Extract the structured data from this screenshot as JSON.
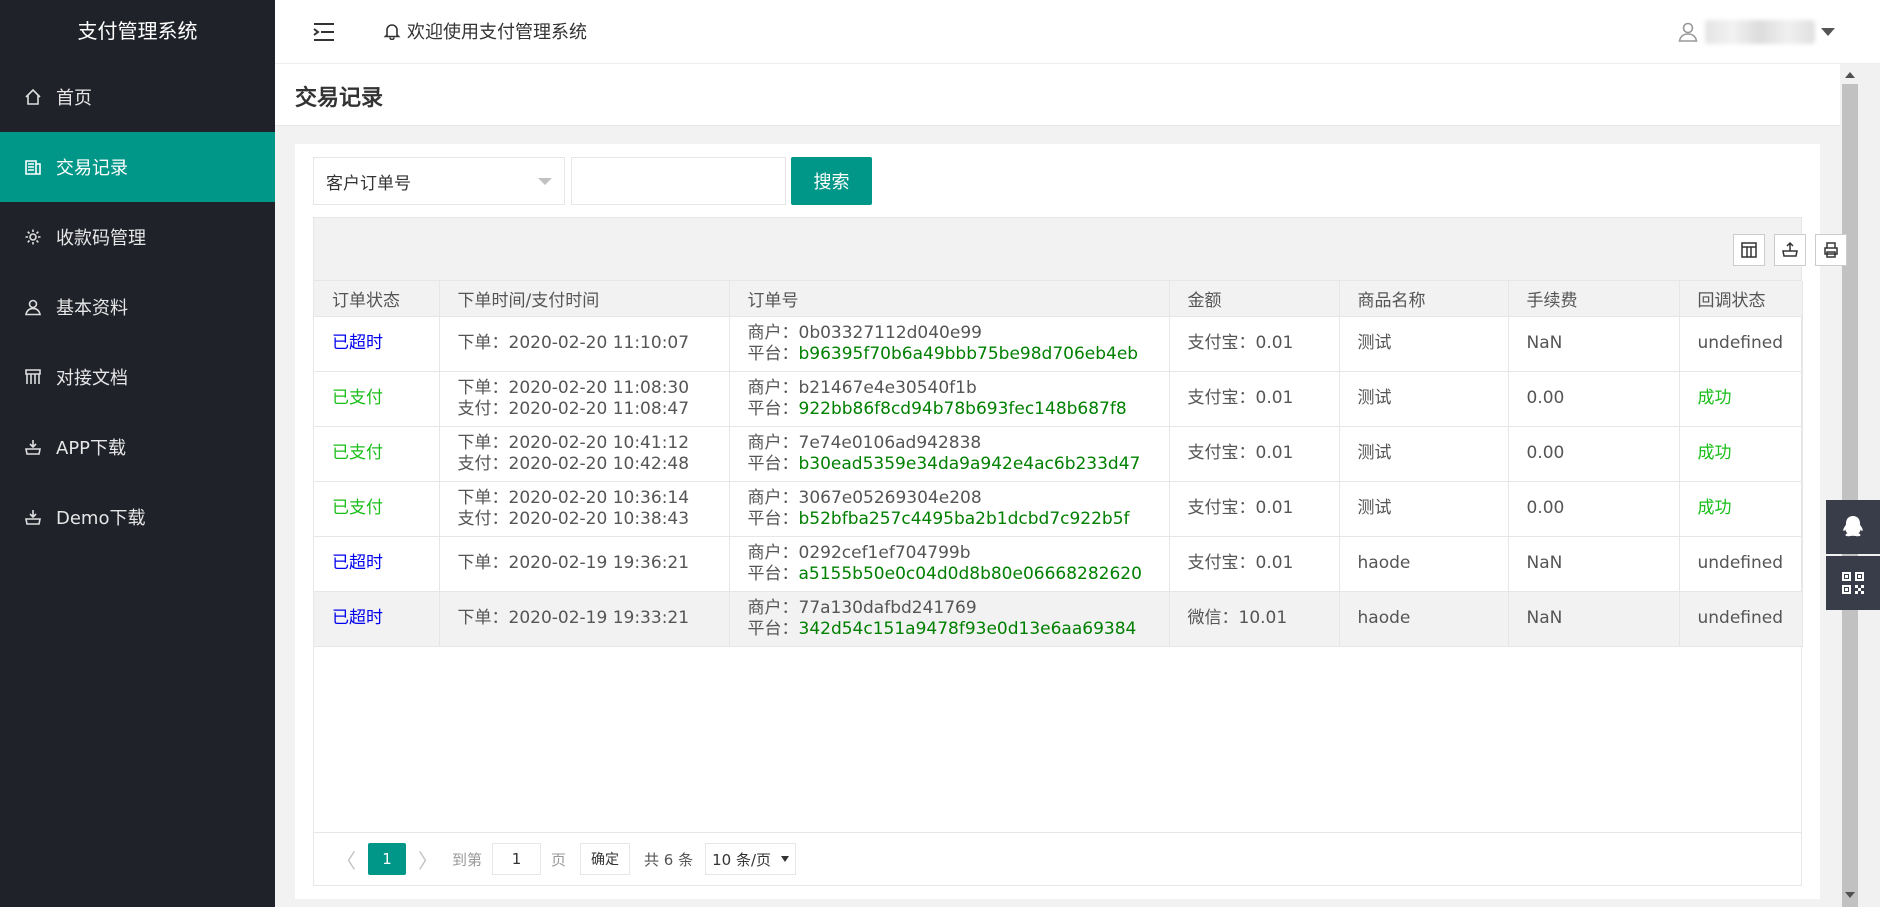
{
  "app": {
    "title": "支付管理系统"
  },
  "sidebar": {
    "items": [
      {
        "label": "首页",
        "icon": "home-icon"
      },
      {
        "label": "交易记录",
        "icon": "records-icon",
        "active": true
      },
      {
        "label": "收款码管理",
        "icon": "gear-icon"
      },
      {
        "label": "基本资料",
        "icon": "user-icon"
      },
      {
        "label": "对接文档",
        "icon": "docs-icon"
      },
      {
        "label": "APP下载",
        "icon": "download-icon"
      },
      {
        "label": "Demo下载",
        "icon": "download-icon"
      }
    ]
  },
  "header": {
    "welcome": "欢迎使用支付管理系统"
  },
  "page": {
    "title": "交易记录"
  },
  "filter": {
    "select_value": "客户订单号",
    "input_value": "",
    "search_label": "搜索"
  },
  "table": {
    "columns": [
      "订单状态",
      "下单时间/支付时间",
      "订单号",
      "金额",
      "商品名称",
      "手续费",
      "回调状态"
    ],
    "rows": [
      {
        "status": "已超时",
        "status_type": "timeout",
        "order_time": "下单：2020-02-20 11:10:07",
        "pay_time": "",
        "merchant_no": "商户：0b03327112d040e99",
        "platform_label": "平台：",
        "platform_no": "b96395f70b6a49bbb75be98d706eb4eb",
        "amount": "支付宝：0.01",
        "product": "测试",
        "fee": "NaN",
        "callback": "undefined",
        "callback_type": "none"
      },
      {
        "status": "已支付",
        "status_type": "paid",
        "order_time": "下单：2020-02-20 11:08:30",
        "pay_time": "支付：2020-02-20 11:08:47",
        "merchant_no": "商户：b21467e4e30540f1b",
        "platform_label": "平台：",
        "platform_no": "922bb86f8cd94b78b693fec148b687f8",
        "amount": "支付宝：0.01",
        "product": "测试",
        "fee": "0.00",
        "callback": "成功",
        "callback_type": "ok"
      },
      {
        "status": "已支付",
        "status_type": "paid",
        "order_time": "下单：2020-02-20 10:41:12",
        "pay_time": "支付：2020-02-20 10:42:48",
        "merchant_no": "商户：7e74e0106ad942838",
        "platform_label": "平台：",
        "platform_no": "b30ead5359e34da9a942e4ac6b233d47",
        "amount": "支付宝：0.01",
        "product": "测试",
        "fee": "0.00",
        "callback": "成功",
        "callback_type": "ok"
      },
      {
        "status": "已支付",
        "status_type": "paid",
        "order_time": "下单：2020-02-20 10:36:14",
        "pay_time": "支付：2020-02-20 10:38:43",
        "merchant_no": "商户：3067e05269304e208",
        "platform_label": "平台：",
        "platform_no": "b52bfba257c4495ba2b1dcbd7c922b5f",
        "amount": "支付宝：0.01",
        "product": "测试",
        "fee": "0.00",
        "callback": "成功",
        "callback_type": "ok"
      },
      {
        "status": "已超时",
        "status_type": "timeout",
        "order_time": "下单：2020-02-19 19:36:21",
        "pay_time": "",
        "merchant_no": "商户：0292cef1ef704799b",
        "platform_label": "平台：",
        "platform_no": "a5155b50e0c04d0d8b80e06668282620",
        "amount": "支付宝：0.01",
        "product": "haode",
        "fee": "NaN",
        "callback": "undefined",
        "callback_type": "none"
      },
      {
        "status": "已超时",
        "status_type": "timeout",
        "order_time": "下单：2020-02-19 19:33:21",
        "pay_time": "",
        "merchant_no": "商户：77a130dafbd241769",
        "platform_label": "平台：",
        "platform_no": "342d54c151a9478f93e0d13e6aa69384",
        "amount": "微信：10.01",
        "product": "haode",
        "fee": "NaN",
        "callback": "undefined",
        "callback_type": "none",
        "highlight": true
      }
    ]
  },
  "pager": {
    "prev": "〈",
    "next": "〉",
    "current": "1",
    "goto_label": "到第",
    "goto_value": "1",
    "page_label": "页",
    "confirm_label": "确定",
    "total": "共 6 条",
    "limit": "10 条/页"
  },
  "colors": {
    "accent": "#009688",
    "sidebar_bg": "#20222a",
    "timeout": "#0000ee",
    "paid": "#19be19",
    "hash": "#008000"
  }
}
